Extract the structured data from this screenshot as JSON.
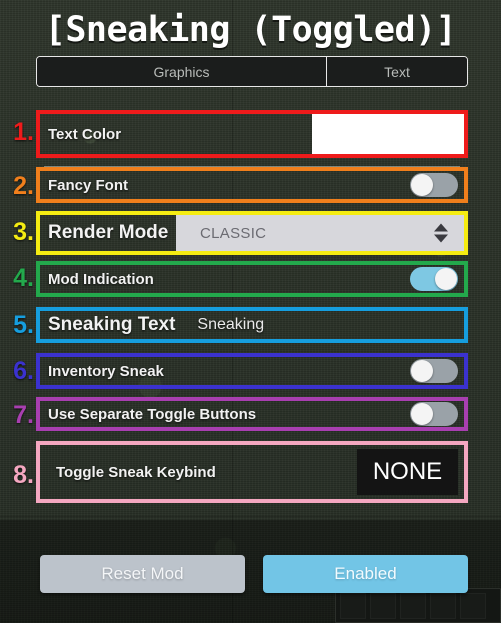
{
  "window": {
    "title": "[Sneaking (Toggled)]"
  },
  "tabs": [
    {
      "label": "Graphics",
      "active": false
    },
    {
      "label": "Text",
      "active": true
    }
  ],
  "annotations": {
    "numbers": [
      "1.",
      "2.",
      "3.",
      "4.",
      "5.",
      "6.",
      "7.",
      "8."
    ],
    "colors": [
      "#ee1b1b",
      "#f07f1c",
      "#f5ec12",
      "#23a94c",
      "#169ede",
      "#3b32cf",
      "#a83fb0",
      "#f4a7c0"
    ]
  },
  "settings": [
    {
      "index": "1.",
      "label": "Text Color",
      "control": "color-swatch",
      "value": "#ffffff",
      "box_color": "#ee1b1b"
    },
    {
      "index": "2.",
      "label": "Fancy Font",
      "control": "toggle",
      "value": "off",
      "box_color": "#f07f1c"
    },
    {
      "index": "3.",
      "label": "Render Mode",
      "control": "dropdown",
      "value": "CLASSIC",
      "box_color": "#f5ec12"
    },
    {
      "index": "4.",
      "label": "Mod Indication",
      "control": "toggle",
      "value": "on",
      "box_color": "#23a94c"
    },
    {
      "index": "5.",
      "label": "Sneaking Text",
      "control": "text-value",
      "value": "Sneaking",
      "box_color": "#169ede"
    },
    {
      "index": "6.",
      "label": "Inventory Sneak",
      "control": "toggle",
      "value": "off",
      "box_color": "#3b32cf"
    },
    {
      "index": "7.",
      "label": "Use Separate Toggle Buttons",
      "control": "toggle",
      "value": "off",
      "box_color": "#a83fb0"
    },
    {
      "index": "8.",
      "label": "Toggle Sneak Keybind",
      "control": "keybind",
      "value": "NONE",
      "box_color": "#f4a7c0"
    }
  ],
  "footer": {
    "reset_label": "Reset Mod",
    "enabled_label": "Enabled",
    "reset_color": "#bcc3cb",
    "enabled_color": "#72c5e6"
  }
}
